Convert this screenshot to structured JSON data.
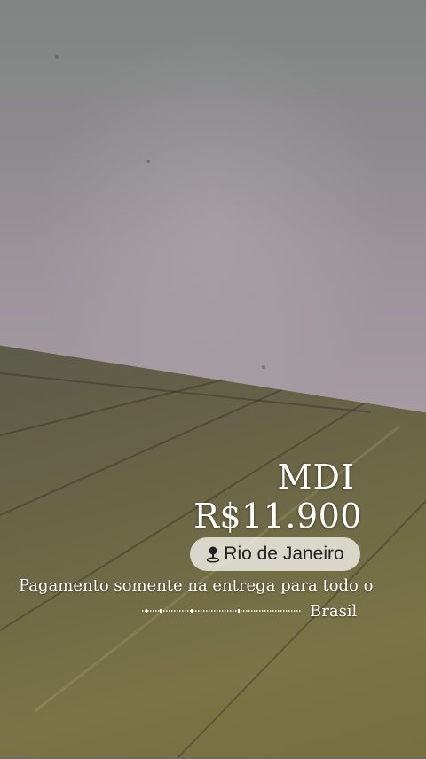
{
  "post": {
    "title": "MDI",
    "price": "R$11.900",
    "location": "Rio de Janeiro",
    "caption_line1": "Pagamento somente na entrega para todo o",
    "caption_line2": "Brasil"
  },
  "icons": {
    "location": "map-pin-icon"
  },
  "colors": {
    "text": "#ffffff",
    "location_pill": "#f0eee8"
  }
}
